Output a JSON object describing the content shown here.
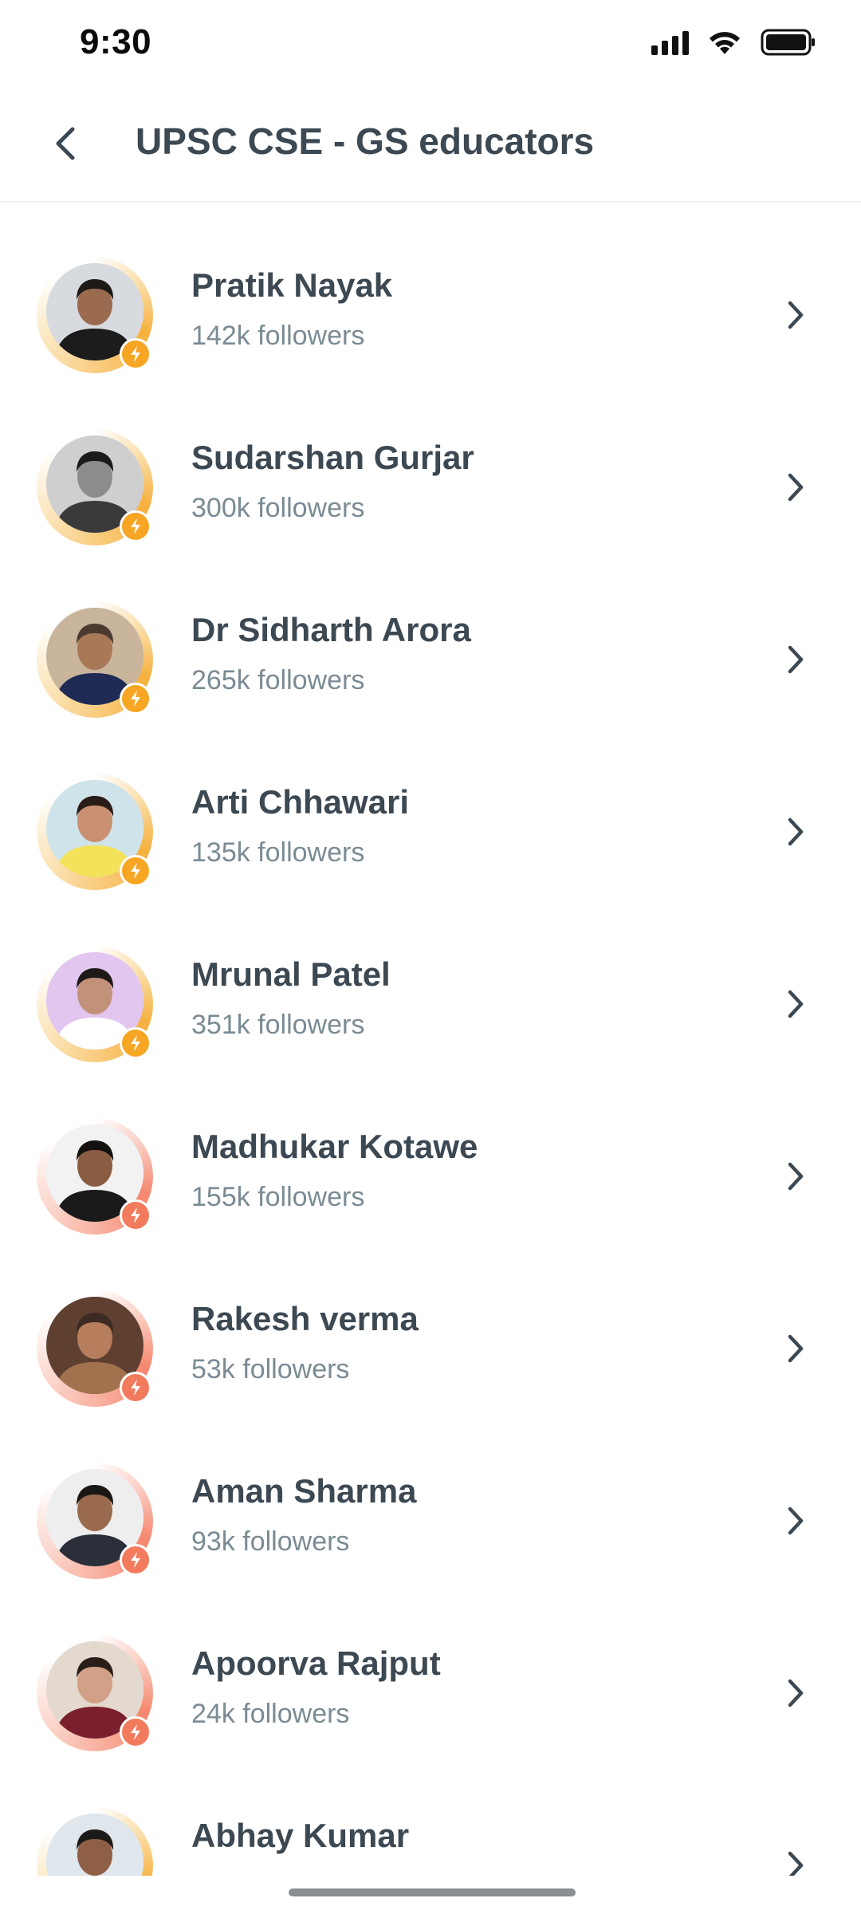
{
  "status_bar": {
    "time": "9:30",
    "icons": [
      "cellular-signal-icon",
      "wifi-icon",
      "battery-icon"
    ]
  },
  "header": {
    "back_icon": "chevron-left-icon",
    "title": "UPSC CSE - GS educators"
  },
  "colors": {
    "text_primary": "#3c4852",
    "text_secondary": "#7a8b94",
    "badge_gold": "#f6a623",
    "badge_coral": "#f37b5d"
  },
  "educators": [
    {
      "name": "Pratik Nayak",
      "followers": "142k followers",
      "tier": "gold",
      "avatar_bg": "#d7dade",
      "shirt": "#1c1c1c",
      "skin": "#9a6b4f",
      "hair": "#1d1a18"
    },
    {
      "name": "Sudarshan Gurjar",
      "followers": "300k followers",
      "tier": "gold",
      "avatar_bg": "#cfcfcf",
      "shirt": "#3a3a3a",
      "skin": "#8c8c8c",
      "hair": "#1b1b1b"
    },
    {
      "name": "Dr Sidharth Arora",
      "followers": "265k followers",
      "tier": "gold",
      "avatar_bg": "#c9b49c",
      "shirt": "#1f2b55",
      "skin": "#a87857",
      "hair": "#4a3a30"
    },
    {
      "name": "Arti Chhawari",
      "followers": "135k followers",
      "tier": "gold",
      "avatar_bg": "#cfe3ea",
      "shirt": "#f3e25a",
      "skin": "#c99072",
      "hair": "#2a1c16"
    },
    {
      "name": "Mrunal Patel",
      "followers": "351k followers",
      "tier": "gold",
      "avatar_bg": "#e3c6ef",
      "shirt": "#ffffff",
      "skin": "#c29179",
      "hair": "#1f1a1a"
    },
    {
      "name": "Madhukar Kotawe",
      "followers": "155k followers",
      "tier": "coral",
      "avatar_bg": "#f2f2f2",
      "shirt": "#1a1a1a",
      "skin": "#8a5c42",
      "hair": "#141210"
    },
    {
      "name": "Rakesh verma",
      "followers": "53k followers",
      "tier": "coral",
      "avatar_bg": "#5f4030",
      "shirt": "#a2724f",
      "skin": "#b77e5d",
      "hair": "#3b2b22"
    },
    {
      "name": "Aman Sharma",
      "followers": "93k followers",
      "tier": "coral",
      "avatar_bg": "#eeeeee",
      "shirt": "#2a2f3a",
      "skin": "#9a6a4e",
      "hair": "#1a1714"
    },
    {
      "name": "Apoorva Rajput",
      "followers": "24k followers",
      "tier": "coral",
      "avatar_bg": "#e4d9cf",
      "shirt": "#7a1f2c",
      "skin": "#d1a086",
      "hair": "#2a1e18"
    },
    {
      "name": "Abhay Kumar",
      "followers": "",
      "tier": "gold",
      "avatar_bg": "#dfe6ec",
      "shirt": "#2c3e62",
      "skin": "#8e5f45",
      "hair": "#1c1a18"
    }
  ]
}
